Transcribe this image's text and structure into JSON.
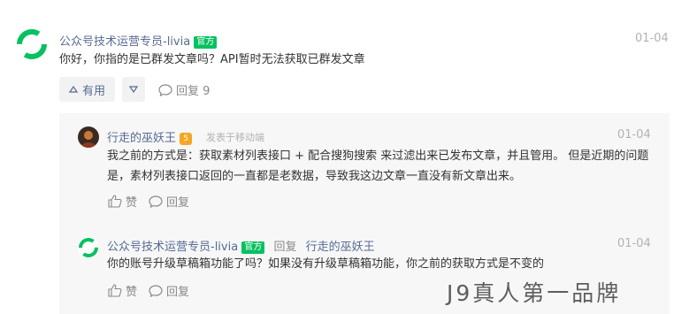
{
  "main_comment": {
    "author": "公众号技术运营专员-livia",
    "badge": "官方",
    "date": "01-04",
    "text": "你好，你指的是已群发文章吗？API暂时无法获取已群发文章",
    "upvote_label": "有用",
    "reply_label": "回复 9"
  },
  "replies": [
    {
      "author": "行走的巫妖王",
      "level_badge": "5",
      "meta": "发表于移动端",
      "date": "01-04",
      "text": "我之前的方式是：获取素材列表接口 + 配合搜狗搜索 来过滤出来已发布文章，并且管用。 但是近期的问题是，素材列表接口返回的一直都是老数据，导致我这边文章一直没有新文章出来。",
      "like_label": "赞",
      "reply_label": "回复"
    },
    {
      "author": "公众号技术运营专员-livia",
      "badge": "官方",
      "reply_word": "回复",
      "reply_to": "行走的巫妖王",
      "date": "01-04",
      "text": "你的账号升级草稿箱功能了吗？如果没有升级草稿箱功能，你之前的获取方式是不变的",
      "like_label": "赞",
      "reply_label": "回复"
    }
  ],
  "watermark": "J9真人第一品牌",
  "colors": {
    "brand_green": "#07c160",
    "link_blue": "#576b95",
    "muted": "#b2b2b2",
    "thread_bg": "#f7f7f7",
    "level_orange": "#f5a623"
  },
  "icons": [
    "wechat-logo-icon",
    "thumbs-up-icon",
    "thumbs-down-icon",
    "comment-bubble-icon",
    "user-avatar-icon"
  ]
}
